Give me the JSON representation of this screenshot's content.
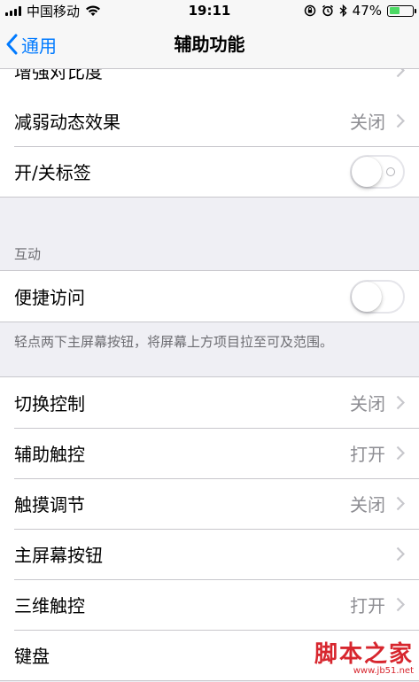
{
  "status_bar": {
    "carrier": "中国移动",
    "time": "19:11",
    "battery_percent": "47%",
    "battery_level": 0.47,
    "battery_color": "#4cd964"
  },
  "nav": {
    "back_label": "通用",
    "title": "辅助功能"
  },
  "accent_color": "#007aff",
  "section_top": {
    "partial_row_label": "增强对比度",
    "rows": [
      {
        "label": "减弱动态效果",
        "value": "关闭"
      },
      {
        "label": "开/关标签",
        "toggle": "off"
      }
    ]
  },
  "section_interaction": {
    "header": "互动",
    "rows": [
      {
        "label": "便捷访问",
        "toggle": "off"
      }
    ],
    "footer": "轻点两下主屏幕按钮，将屏幕上方项目拉至可及范围。"
  },
  "section_controls": {
    "rows": [
      {
        "label": "切换控制",
        "value": "关闭"
      },
      {
        "label": "辅助触控",
        "value": "打开"
      },
      {
        "label": "触摸调节",
        "value": "关闭"
      },
      {
        "label": "主屏幕按钮",
        "value": ""
      },
      {
        "label": "三维触控",
        "value": "打开"
      },
      {
        "label": "键盘",
        "value": ""
      }
    ]
  },
  "watermark": {
    "main": "脚本之家",
    "sub": "www.jb51.net"
  }
}
